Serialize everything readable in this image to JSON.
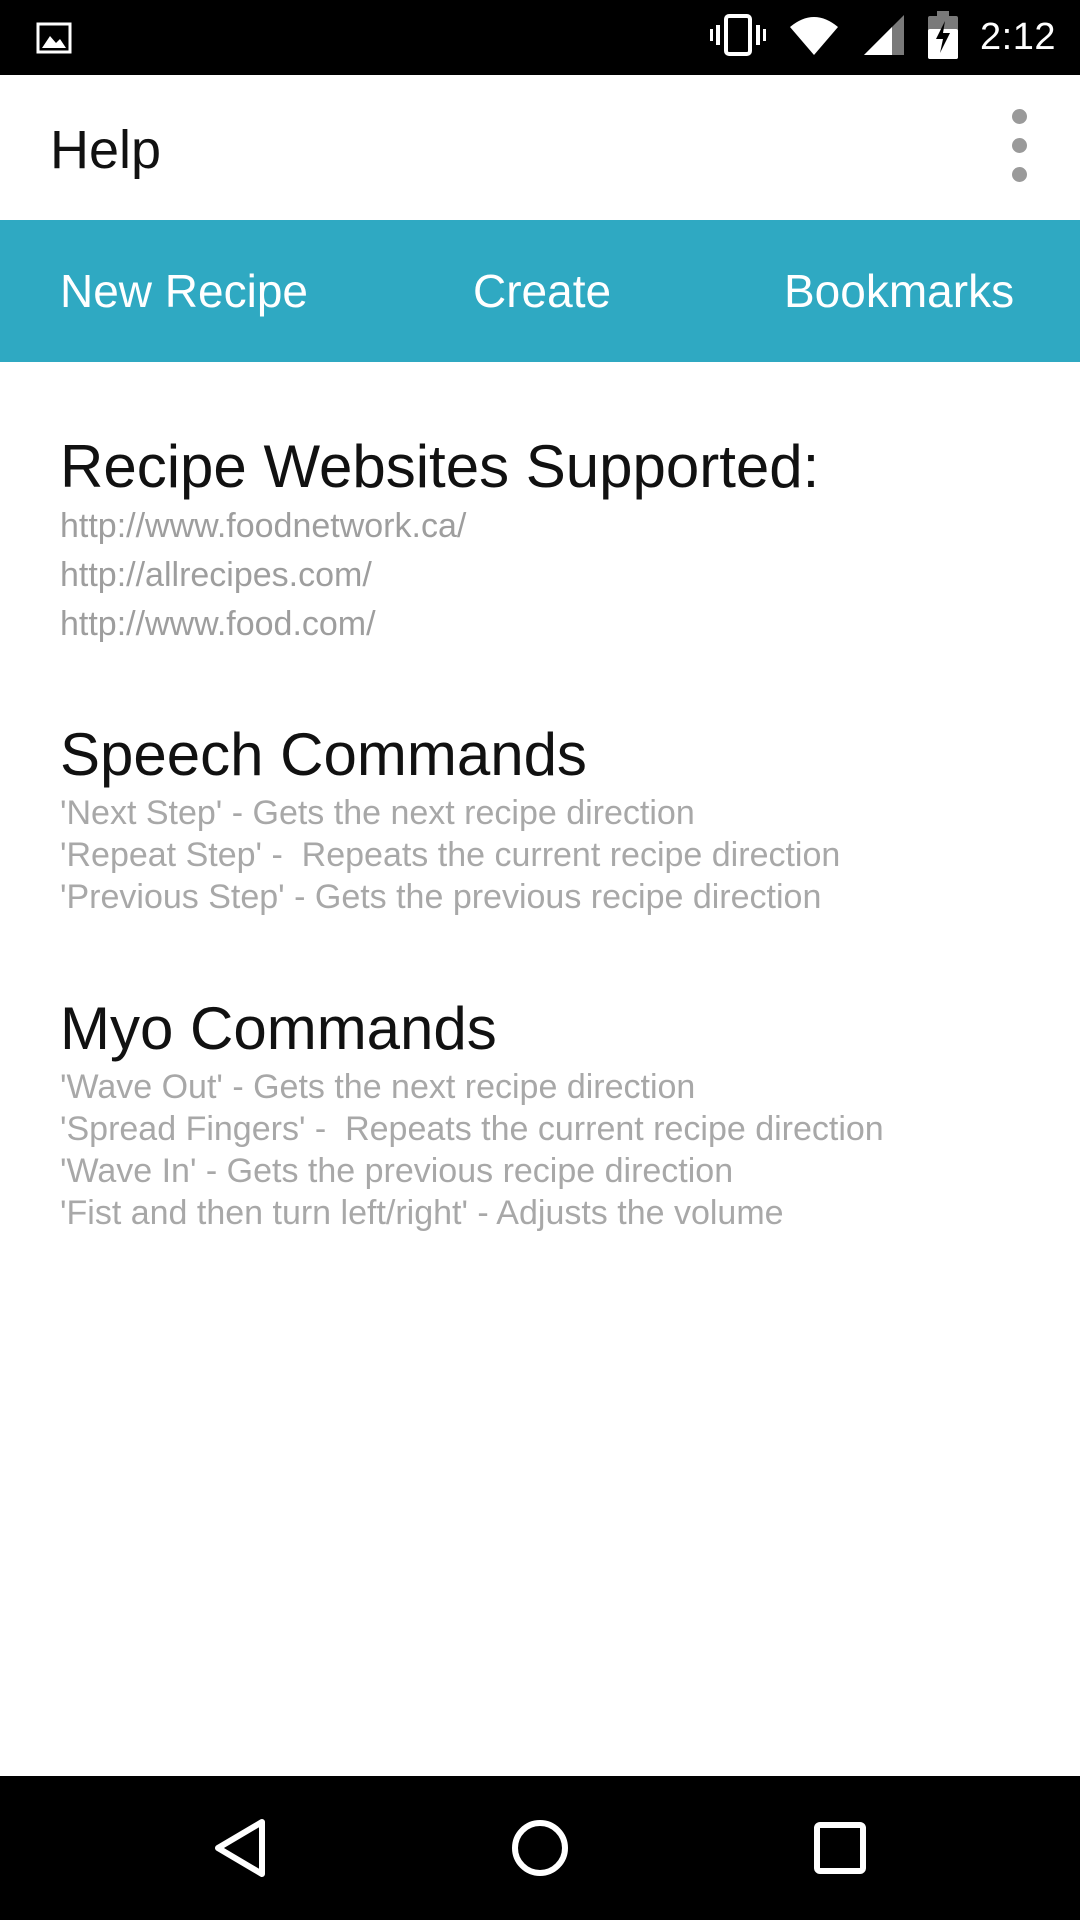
{
  "status_bar": {
    "time": "2:12",
    "left_icon": "image-icon",
    "right_icons": [
      "vibrate-icon",
      "wifi-icon",
      "cell-signal-icon",
      "battery-charging-icon"
    ]
  },
  "app_bar": {
    "title": "Help",
    "menu_icon": "overflow-menu-icon"
  },
  "tabs": [
    {
      "label": "New Recipe"
    },
    {
      "label": "Create"
    },
    {
      "label": "Bookmarks"
    }
  ],
  "sections": {
    "websites": {
      "title": "Recipe Websites Supported:",
      "items": [
        "http://www.foodnetwork.ca/",
        "http://allrecipes.com/",
        "http://www.food.com/"
      ]
    },
    "speech": {
      "title": "Speech Commands",
      "items": [
        "'Next Step' - Gets the next recipe direction",
        "'Repeat Step' -  Repeats the current recipe direction",
        "'Previous Step' - Gets the previous recipe direction"
      ]
    },
    "myo": {
      "title": "Myo Commands",
      "items": [
        "'Wave Out' - Gets the next recipe direction",
        "'Spread Fingers' -  Repeats the current recipe direction",
        "'Wave In' - Gets the previous recipe direction",
        "'Fist and then turn left/right' - Adjusts the volume"
      ]
    }
  },
  "nav_bar": {
    "buttons": [
      "back-icon",
      "home-icon",
      "recents-icon"
    ]
  },
  "colors": {
    "tab_bar": "#2fa9c2",
    "status_bar": "#000000",
    "secondary_text": "#a8a8a8"
  }
}
